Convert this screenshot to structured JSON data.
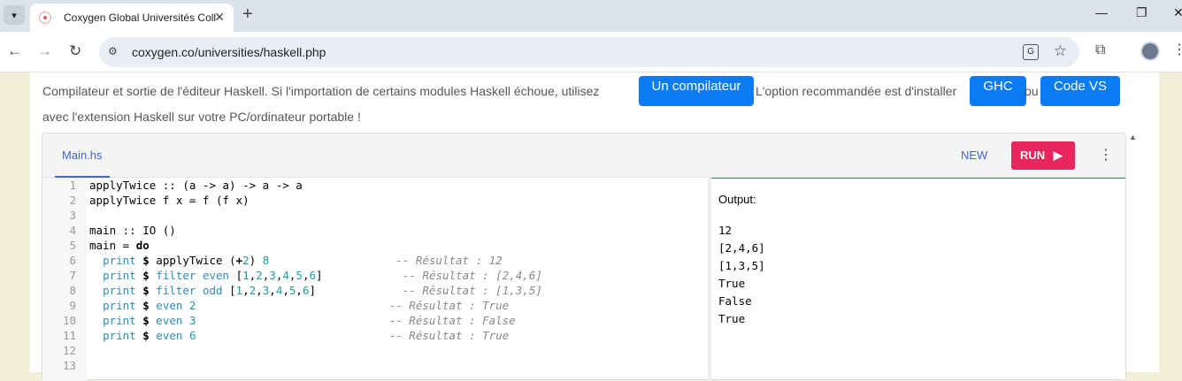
{
  "browser": {
    "tab_title": "Coxygen Global Universités Coll",
    "url": "coxygen.co/universities/haskell.php"
  },
  "intro": {
    "text_part1": "Compilateur et sortie de l'éditeur Haskell. Si l'importation de certains modules Haskell échoue, utilisez",
    "btn_compiler": "Un compilateur",
    "text_part2": "L'option recommandée est d'installer",
    "btn_ghc": "GHC",
    "text_ou": "ou",
    "btn_vscode": "Code VS",
    "line2": "avec l'extension Haskell sur votre PC/ordinateur portable !"
  },
  "editor": {
    "file_tab": "Main.hs",
    "new_label": "NEW",
    "run_label": "RUN",
    "lines": [
      {
        "num": "1"
      },
      {
        "num": "2"
      },
      {
        "num": "3"
      },
      {
        "num": "4"
      },
      {
        "num": "5"
      },
      {
        "num": "6"
      },
      {
        "num": "7"
      },
      {
        "num": "8"
      },
      {
        "num": "9"
      },
      {
        "num": "10"
      },
      {
        "num": "11"
      },
      {
        "num": "12"
      },
      {
        "num": "13"
      }
    ],
    "code": {
      "l1": "applyTwice :: (a -> a) -> a -> a",
      "l2": "applyTwice f x = f (f x)",
      "l4": "main :: IO ()",
      "l5a": "main = ",
      "l5b": "do",
      "l6": "-- Résultat : 12",
      "l7": "-- Résultat : [2,4,6]",
      "l8": "-- Résultat : [1,3,5]",
      "l9": "-- Résultat : True",
      "l10": "-- Résultat : False",
      "l11": "-- Résultat : True"
    }
  },
  "output": {
    "label": "Output:",
    "lines": "12\n[2,4,6]\n[1,3,5]\nTrue\nFalse\nTrue"
  }
}
